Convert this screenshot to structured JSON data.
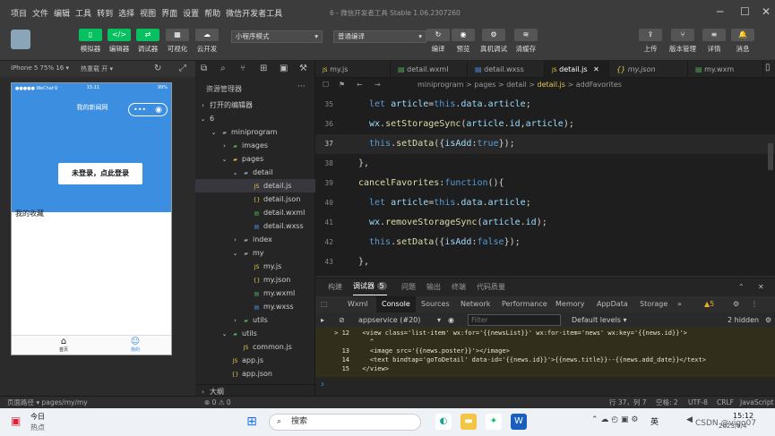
{
  "menubar": {
    "items": [
      "项目",
      "文件",
      "编辑",
      "工具",
      "转到",
      "选择",
      "视图",
      "界面",
      "设置",
      "帮助",
      "微信开发者工具"
    ],
    "window_title": "6 - 微信开发者工具 Stable 1.06.2307260"
  },
  "toolbar": {
    "left": [
      {
        "label": "模拟器",
        "icon": "phone-icon"
      },
      {
        "label": "编辑器",
        "icon": "code-icon"
      },
      {
        "label": "调试器",
        "icon": "debug-icon"
      },
      {
        "label": "可视化",
        "icon": "visual-icon"
      },
      {
        "label": "云开发",
        "icon": "cloud-icon"
      }
    ],
    "mode_select": "小程序模式",
    "compile_select": "普通编译",
    "center": [
      {
        "label": "编译",
        "icon": "refresh-icon"
      },
      {
        "label": "预览",
        "icon": "eye-icon"
      },
      {
        "label": "真机调试",
        "icon": "bug-icon"
      },
      {
        "label": "清缓存",
        "icon": "layers-icon"
      }
    ],
    "right": [
      {
        "label": "上传",
        "icon": "upload-icon"
      },
      {
        "label": "版本管理",
        "icon": "version-icon"
      },
      {
        "label": "详情",
        "icon": "menu-icon"
      },
      {
        "label": "消息",
        "icon": "bell-icon"
      }
    ]
  },
  "simulator": {
    "device": "iPhone 5 75% 16 ▾",
    "hot_reload": "热重载 开 ▾",
    "status_carrier": "●●●●● WeChat令",
    "status_time": "15:11",
    "status_battery": "99%",
    "page_title": "我的新闻网",
    "capsule_dots": "•••",
    "login_button": "未登录，点此登录",
    "favorites_label": "我的收藏",
    "tabs": [
      {
        "label": "首页",
        "icon": "home-icon"
      },
      {
        "label": "我的",
        "icon": "user-icon"
      }
    ]
  },
  "explorer": {
    "title": "资源管理器",
    "more": "···",
    "open_editors": "打开的编辑器",
    "rows": [
      {
        "label": "6",
        "indent": 0,
        "arrow": "⌄",
        "icon": "",
        "color": "#ccc"
      },
      {
        "label": "miniprogram",
        "indent": 1,
        "arrow": "⌄",
        "icon": "▰",
        "color": "#8da0b3"
      },
      {
        "label": "images",
        "indent": 2,
        "arrow": "›",
        "icon": "▰",
        "color": "#4caf50"
      },
      {
        "label": "pages",
        "indent": 2,
        "arrow": "⌄",
        "icon": "▰",
        "color": "#d8b24a"
      },
      {
        "label": "detail",
        "indent": 3,
        "arrow": "⌄",
        "icon": "▰",
        "color": "#8da0b3"
      },
      {
        "label": "detail.js",
        "indent": 4,
        "arrow": "",
        "icon": "JS",
        "color": "#e6c84a",
        "active": true
      },
      {
        "label": "detail.json",
        "indent": 4,
        "arrow": "",
        "icon": "{}",
        "color": "#e6c84a"
      },
      {
        "label": "detail.wxml",
        "indent": 4,
        "arrow": "",
        "icon": "▤",
        "color": "#4caf50"
      },
      {
        "label": "detail.wxss",
        "indent": 4,
        "arrow": "",
        "icon": "▤",
        "color": "#4a90d9"
      },
      {
        "label": "index",
        "indent": 3,
        "arrow": "›",
        "icon": "▰",
        "color": "#8da0b3"
      },
      {
        "label": "my",
        "indent": 3,
        "arrow": "⌄",
        "icon": "▰",
        "color": "#8da0b3"
      },
      {
        "label": "my.js",
        "indent": 4,
        "arrow": "",
        "icon": "JS",
        "color": "#e6c84a"
      },
      {
        "label": "my.json",
        "indent": 4,
        "arrow": "",
        "icon": "{}",
        "color": "#e6c84a"
      },
      {
        "label": "my.wxml",
        "indent": 4,
        "arrow": "",
        "icon": "▤",
        "color": "#4caf50"
      },
      {
        "label": "my.wxss",
        "indent": 4,
        "arrow": "",
        "icon": "▤",
        "color": "#4a90d9"
      },
      {
        "label": "utils",
        "indent": 3,
        "arrow": "›",
        "icon": "▰",
        "color": "#4caf50"
      },
      {
        "label": "utils",
        "indent": 2,
        "arrow": "⌄",
        "icon": "▰",
        "color": "#4caf50"
      },
      {
        "label": "common.js",
        "indent": 3,
        "arrow": "",
        "icon": "JS",
        "color": "#e6c84a"
      },
      {
        "label": "app.js",
        "indent": 2,
        "arrow": "",
        "icon": "JS",
        "color": "#e6c84a"
      },
      {
        "label": "app.json",
        "indent": 2,
        "arrow": "",
        "icon": "{}",
        "color": "#e6c84a"
      }
    ],
    "outline": "大纲"
  },
  "editor": {
    "tabs": [
      {
        "label": "my.js",
        "icon": "JS"
      },
      {
        "label": "detail.wxml",
        "icon": "▤"
      },
      {
        "label": "detail.wxss",
        "icon": "▤"
      },
      {
        "label": "detail.js",
        "icon": "JS",
        "active": true,
        "close": "✕"
      },
      {
        "label": "my.json",
        "icon": "{}"
      },
      {
        "label": "my.wxm",
        "icon": "▤"
      }
    ],
    "breadcrumb": [
      "miniprogram",
      "pages",
      "detail",
      "detail.js",
      "addFavorites"
    ],
    "breadcrumb_sep": ">",
    "code_lines": [
      {
        "n": "35",
        "text": "let article=this.data.article;",
        "indent": 1
      },
      {
        "n": "36",
        "text": "wx.setStorageSync(article.id,article);",
        "indent": 1
      },
      {
        "n": "37",
        "text": "this.setData({isAdd:true});",
        "indent": 1,
        "current": true
      },
      {
        "n": "38",
        "text": "},",
        "indent": 0
      },
      {
        "n": "39",
        "text": "cancelFavorites:function(){",
        "indent": 0
      },
      {
        "n": "40",
        "text": "let article=this.data.article;",
        "indent": 1
      },
      {
        "n": "41",
        "text": "wx.removeStorageSync(article.id);",
        "indent": 1
      },
      {
        "n": "42",
        "text": "this.setData({isAdd:false});",
        "indent": 1
      },
      {
        "n": "43",
        "text": "},",
        "indent": 0
      }
    ]
  },
  "debug_panel": {
    "tabs": [
      {
        "label": "构建"
      },
      {
        "label": "调试器",
        "badge": "5",
        "active": true
      },
      {
        "label": "问题"
      },
      {
        "label": "输出"
      },
      {
        "label": "终端"
      },
      {
        "label": "代码质量"
      }
    ],
    "devtools_tabs": [
      "Wxml",
      "Console",
      "Sources",
      "Network",
      "Performance",
      "Memory",
      "AppData",
      "Storage",
      "»"
    ],
    "active_devtools_tab": "Console",
    "warning_count": "▲5",
    "context_select": "appservice (#20)",
    "filter_placeholder": "Filter",
    "levels": "Default levels ▾",
    "hidden_count": "2 hidden",
    "console_lines": [
      {
        "n": "> 12",
        "text": "  <view class='list-item' wx:for='{{newsList}}' wx:for-item='news' wx:key='{{news.id}}'>"
      },
      {
        "n": "",
        "text": "    ^"
      },
      {
        "n": "13",
        "text": "    <image src='{{news.poster}}'></image>"
      },
      {
        "n": "14",
        "text": "    <text bindtap='goToDetail' data-id='{{news.id}}'>{{news.title}}--{{news.add_date}}</text>"
      },
      {
        "n": "15",
        "text": "  </view>"
      }
    ],
    "prompt": "›"
  },
  "status_bar": {
    "page_path": "页面路径 ▾  pages/my/my",
    "errors": "⊗ 0 ⚠ 0",
    "position": "行 37，列 7",
    "spaces": "空格: 2",
    "encoding": "UTF-8",
    "eol": "CRLF",
    "language": "JavaScript"
  },
  "taskbar": {
    "weather_label": "今日",
    "weather_sub": "热点",
    "search_placeholder": "搜索",
    "lang": "英",
    "time": "15:12",
    "date": "2023/9/4",
    "watermark": "CSDN @vigo07"
  }
}
